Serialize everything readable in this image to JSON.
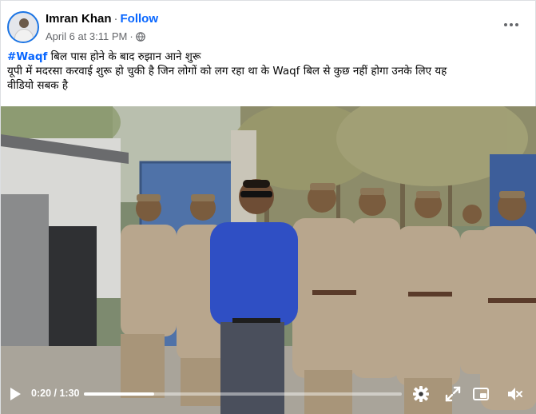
{
  "post": {
    "author": "Imran Khan",
    "separator": "·",
    "follow_label": "Follow",
    "timestamp": "April 6 at 3:11 PM",
    "meta_separator": "·",
    "privacy_icon": "globe-icon",
    "more_icon": "more-options-icon",
    "hashtag": "#Waqf",
    "line1_rest": " बिल पास होने के बाद रुझान आने शुरू",
    "line2": "यूपी में मदरसा करवाई शुरू हो चुकी है जिन लोगों को लग रहा था के Waqf बिल से कुछ नहीं होगा उनके लिए यह",
    "line3": "वीडियो सबक है"
  },
  "video": {
    "current_time": "0:20",
    "time_separator": " / ",
    "duration": "1:30",
    "progress_fraction": 0.222,
    "icons": [
      "play-icon",
      "settings-icon",
      "expand-icon",
      "picture-in-picture-icon",
      "mute-icon"
    ]
  },
  "colors": {
    "accent": "#0866ff",
    "secondary_text": "#65676b",
    "uniform": "#b8a68d",
    "shirt": "#2f4fc4"
  }
}
